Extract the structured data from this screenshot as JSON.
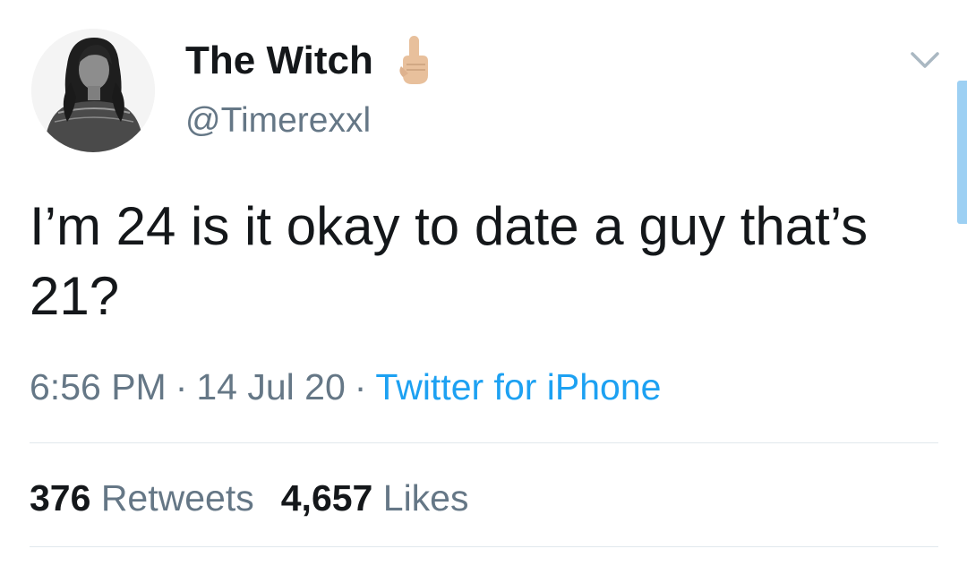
{
  "user": {
    "display_name": "The Witch",
    "name_emoji": "middle-finger-emoji-icon",
    "handle": "@Timerexxl",
    "avatar": "profile-photo"
  },
  "tweet": {
    "text": "I’m 24 is it okay to date a guy that’s 21?",
    "time": "6:56 PM",
    "date": "14 Jul 20",
    "separator": "·",
    "source": "Twitter for iPhone"
  },
  "stats": {
    "retweets_count": "376",
    "retweets_label": "Retweets",
    "likes_count": "4,657",
    "likes_label": "Likes"
  },
  "icons": {
    "menu": "chevron-down-icon"
  },
  "colors": {
    "text": "#14171a",
    "secondary": "#657786",
    "link": "#1da1f2",
    "divider": "#e1e8ed",
    "scroll_indicator": "#9dd0f3"
  }
}
